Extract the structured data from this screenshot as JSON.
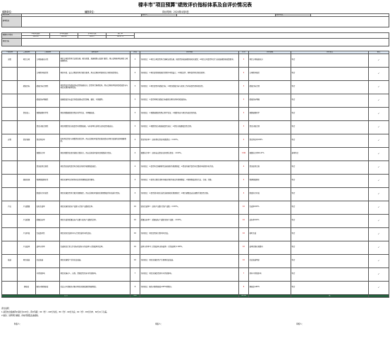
{
  "doc": {
    "title": "禄丰市\"项目预算\"绩效评价指标体系及自评价情况表",
    "unit_label": "填报单位：",
    "date_label": "评价时间：2024年4月8日",
    "project_label": "项目名称：",
    "unit_name_label": "编报单位：",
    "contact_label": "联系人：",
    "phone_label": "联系电话：",
    "basic_label": "基本情况",
    "budget_label": "预算执行情况",
    "goal_label": "项目目标",
    "header": {
      "col1": "一级指标",
      "col2": "二级指标",
      "col3": "三级指标",
      "col4": "指标说明",
      "col5": "分值",
      "col6": "评价标准",
      "col7": "评分",
      "col8": "评价依据",
      "col9": "评价要点",
      "col10": "备注"
    },
    "section_process": "过程",
    "section_output": "产出",
    "section_effect": "效益",
    "score_total": "100",
    "budget_row": {
      "col1": "年初预算数",
      "col2": "全年预算数",
      "col3": "全年执行数",
      "v1": "100.00",
      "v2": "100.00",
      "v3": "96.47",
      "rate_label": "执行率",
      "rate": "96.47%"
    },
    "foot1": "评分说明：",
    "foot2": "1.项目支出绩效评价满分为100分，评价等级：90（含）-100分为优、80（含）-90分为良、60（含）-80分为中、60分以下为差。",
    "foot3": "2.备注：说明评分依据、存在问题及改进措施。",
    "foot4": "制表人：",
    "foot5": "填表人：",
    "foot6": "审核人："
  },
  "rows": [
    {
      "l1": "决策",
      "l2": "项目立项",
      "l3": "立项依据充分性",
      "desc": "项目立项是否符合法律法规、相关政策、发展规划以及部门职责，用以反映和考核项目立项依据情况。",
      "score": "3",
      "eval": "评价要点：①项目立项是否符合国家法律法规、国民经济发展规划和相关政策；②项目立项是否符合行业发展规划和政策要求。",
      "got": "3",
      "basis": "项目立项依据充分",
      "point": "符合",
      "note": "✓"
    },
    {
      "l1": "",
      "l2": "",
      "l3": "立项程序规范性",
      "desc": "项目申请、设立过程是否符合相关要求，用以反映和考核项目立项的规范情况。",
      "score": "2",
      "eval": "评价要点：①项目是否按照规定的程序申请设立；②审批文件、材料是否符合相关要求。",
      "got": "2",
      "basis": "立项程序规范",
      "point": "符合",
      "note": "✓"
    },
    {
      "l1": "",
      "l2": "绩效目标",
      "l3": "绩效目标合理性",
      "desc": "项目所设定的绩效目标是否依据充分，是否符合客观实际，用以反映和考核项目绩效目标与项目实施的相符情况。",
      "score": "3",
      "eval": "评价要点：①项目是否有绩效目标；②项目绩效目标与实际工作内容是否具有相关性。",
      "got": "3",
      "basis": "绩效目标合理",
      "point": "符合",
      "note": "✓"
    },
    {
      "l1": "",
      "l2": "",
      "l3": "绩效指标明确性",
      "desc": "依据绩效目标设定的绩效指标是否清晰、细化、可衡量等。",
      "score": "3",
      "eval": "评价要点：①是否将项目绩效目标细化分解为具体的绩效指标。",
      "got": "3",
      "basis": "绩效指标明确",
      "point": "符合",
      "note": "✓"
    },
    {
      "l1": "",
      "l2": "资金投入",
      "l3": "预算编制科学性",
      "desc": "项目预算编制是否经过科学论证、有明确标准。",
      "score": "3",
      "eval": "评价要点：①预算编制是否经过科学论证；②预算内容与项目内容是否匹配。",
      "got": "3",
      "basis": "预算编制科学",
      "point": "符合",
      "note": "✓"
    },
    {
      "l1": "",
      "l2": "",
      "l3": "资金分配合理性",
      "desc": "项目预算资金分配是否有测算依据，与补助单位或地方实际是否相适应。",
      "score": "3",
      "eval": "评价要点：①预算资金分配依据是否充分；②资金分配额度是否合理。",
      "got": "3",
      "basis": "资金分配合理",
      "point": "符合",
      "note": "✓"
    },
    {
      "l1": "过程",
      "l2": "资金管理",
      "l3": "资金到位率",
      "desc": "实际到位资金与预算资金的比率，用以反映和考核资金落实情况对项目实施的总体保障程度。",
      "score": "4",
      "eval": "资金到位率=（实际到位资金/预算资金）×100%。",
      "got": "4",
      "basis": "资金到位率100%",
      "point": "符合",
      "note": "✓"
    },
    {
      "l1": "",
      "l2": "",
      "l3": "预算执行率",
      "desc": "项目预算资金是否按照计划执行，用以反映或考核项目预算执行情况。",
      "score": "4",
      "eval": "预算执行率=（实际支出资金/实际到位资金）×100%。",
      "got": "3.86",
      "basis": "预算执行率96.47%",
      "point": "基本符合",
      "note": "✓"
    },
    {
      "l1": "",
      "l2": "",
      "l3": "资金使用合规性",
      "desc": "项目资金使用是否符合相关的财务管理制度规定。",
      "score": "4",
      "eval": "评价要点：①是否符合国家财经法规和财务管理制度；②资金的拨付是否有完整的审批程序和手续。",
      "got": "4",
      "basis": "资金使用合规",
      "point": "符合",
      "note": "✓"
    },
    {
      "l1": "",
      "l2": "组织实施",
      "l3": "管理制度健全性",
      "desc": "项目实施单位的财务和业务管理制度是否健全。",
      "score": "4",
      "eval": "评价要点：①是否已制定或具有相应的财务和业务管理制度；②管理制度是否合法、合规、完整。",
      "got": "4",
      "basis": "管理制度健全",
      "point": "符合",
      "note": "✓"
    },
    {
      "l1": "",
      "l2": "",
      "l3": "制度执行有效性",
      "desc": "项目实施是否符合相关管理规定，用以反映和考核相关管理制度的有效执行情况。",
      "score": "4",
      "eval": "评价要点：①是否遵守相关法律法规和相关管理规定；②项目调整及支出调整手续是否完备。",
      "got": "4",
      "basis": "制度执行有效",
      "point": "符合",
      "note": "✓"
    },
    {
      "l1": "产出",
      "l2": "产出数量",
      "l3": "实际完成率",
      "desc": "项目实施的实际产出数与计划产出数的比率。",
      "score": "10",
      "eval": "实际完成率=（实际产出数/计划产出数）×100%。",
      "got": "10",
      "basis": "完成率100%",
      "point": "符合",
      "note": "✓"
    },
    {
      "l1": "",
      "l2": "产出质量",
      "l3": "质量达标率",
      "desc": "项目完成的质量达标产出数与实际产出数的比率。",
      "score": "10",
      "eval": "质量达标率=（质量达标产出数/实际产出数）×100%。",
      "got": "10",
      "basis": "达标率100%",
      "point": "符合",
      "note": "✓"
    },
    {
      "l1": "",
      "l2": "产出时效",
      "l3": "完成及时性",
      "desc": "项目实际完成时间与计划完成时间的比较。",
      "score": "10",
      "eval": "评价要点：项目是否按计划时间完成。",
      "got": "10",
      "basis": "按时完成",
      "point": "符合",
      "note": "✓"
    },
    {
      "l1": "",
      "l2": "产出成本",
      "l3": "成本节约率",
      "desc": "完成项目计划工作目标的实际节约成本与计划成本的比率。",
      "score": "10",
      "eval": "成本节约率=[（计划成本-实际成本）/计划成本]×100%。",
      "got": "10",
      "basis": "成本控制在预算内",
      "point": "符合",
      "note": "✓"
    },
    {
      "l1": "效益",
      "l2": "项目效益",
      "l3": "社会效益",
      "desc": "项目实施所产生的社会效益。",
      "score": "10",
      "eval": "评价要点：项目实施是否产生预期社会效益。",
      "got": "10",
      "basis": "社会效益明显",
      "point": "符合",
      "note": "✓"
    },
    {
      "l1": "",
      "l2": "",
      "l3": "可持续影响",
      "desc": "项目实施对人、自然、资源是否带来可持续影响。",
      "score": "7",
      "eval": "评价要点：项目实施是否具有可持续影响。",
      "got": "7",
      "basis": "具有可持续影响",
      "point": "符合",
      "note": "✓"
    },
    {
      "l1": "",
      "l2": "满意度",
      "l3": "服务对象满意度",
      "desc": "社会公众或服务对象对项目实施效果的满意程度。",
      "score": "6",
      "eval": "评价要点：服务对象满意度≥90%得满分。",
      "got": "6",
      "basis": "满意度≥90%",
      "point": "符合",
      "note": "✓"
    }
  ],
  "total": {
    "label": "合计",
    "score": "100",
    "got": "99.86",
    "basis": "",
    "point": "优"
  }
}
